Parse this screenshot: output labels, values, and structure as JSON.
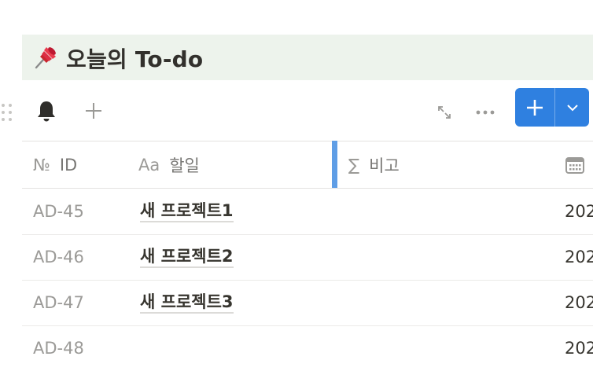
{
  "page": {
    "title": "오늘의 To-do",
    "title_icon": "pushpin-icon",
    "title_bg": "#edf3ec"
  },
  "toolbar": {
    "icons": [
      "bell-icon",
      "plus-icon",
      "expand-icon",
      "more-icon"
    ],
    "new_button_color": "#2f80e0"
  },
  "table": {
    "columns": [
      {
        "icon": "№",
        "label": "ID"
      },
      {
        "icon": "Aa",
        "label": "할일"
      },
      {
        "icon": "∑",
        "label": "비고"
      },
      {
        "icon": "calendar-icon",
        "label": ""
      }
    ],
    "rows": [
      {
        "id": "AD-45",
        "task": "새 프로젝트1",
        "date": "202"
      },
      {
        "id": "AD-46",
        "task": "새 프로젝트2",
        "date": "202"
      },
      {
        "id": "AD-47",
        "task": "새 프로젝트3",
        "date": "202"
      },
      {
        "id": "AD-48",
        "task": "",
        "date": "202"
      }
    ]
  }
}
